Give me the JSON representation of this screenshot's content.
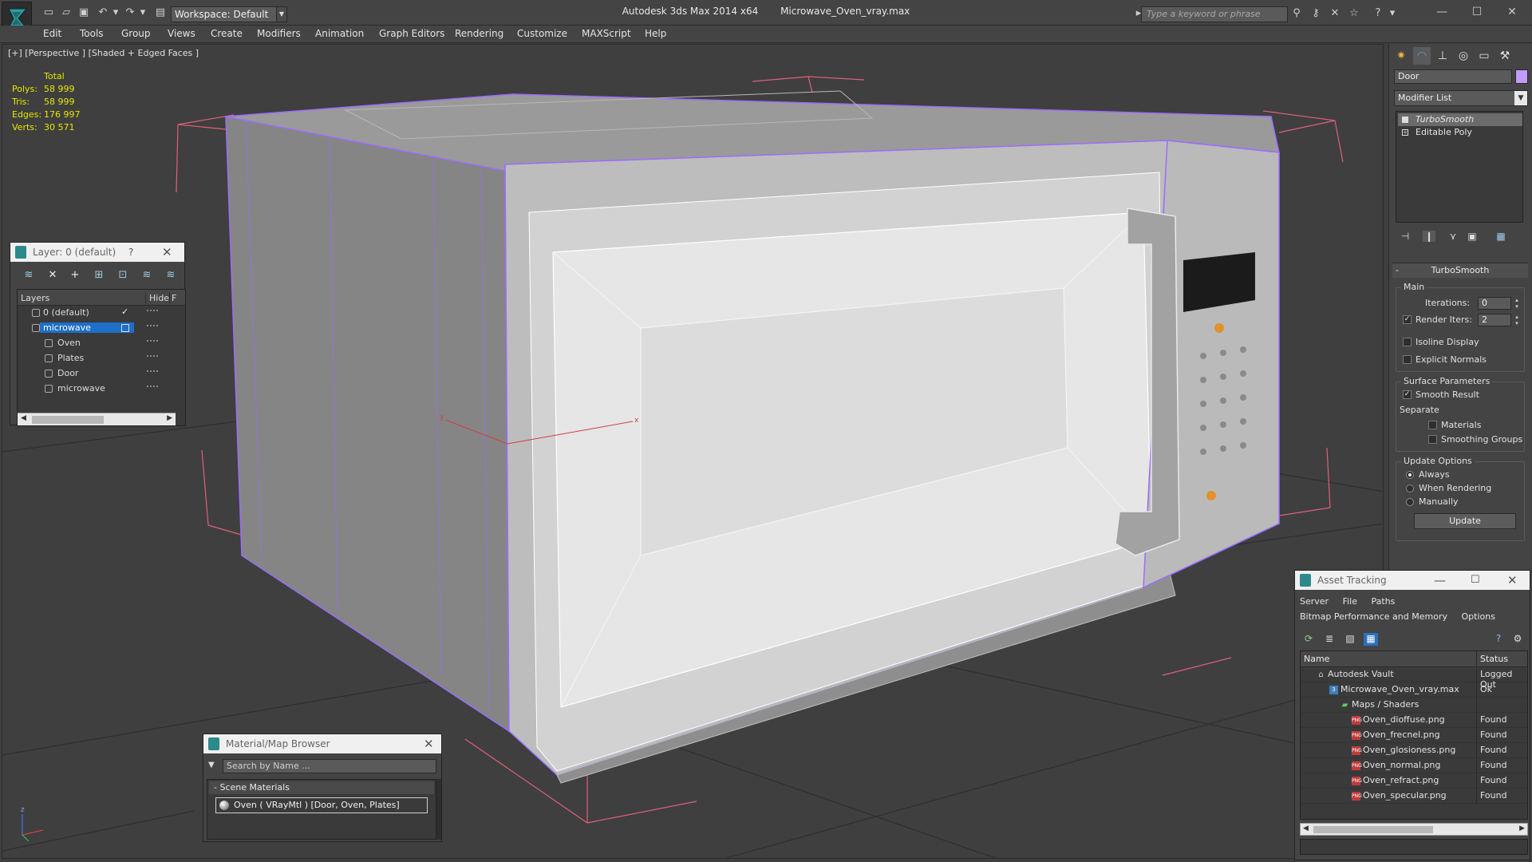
{
  "titlebar": {
    "app_title": "Autodesk 3ds Max  2014 x64",
    "file_title": "Microwave_Oven_vray.max",
    "workspace": "Workspace: Default",
    "search_placeholder": "Type a keyword or phrase"
  },
  "menu": [
    "Edit",
    "Tools",
    "Group",
    "Views",
    "Create",
    "Modifiers",
    "Animation",
    "Graph Editors",
    "Rendering",
    "Customize",
    "MAXScript",
    "Help"
  ],
  "viewport": {
    "label": "[+] [Perspective ] [Shaded + Edged Faces ]",
    "stats": {
      "total_label": "Total",
      "rows": [
        {
          "label": "Polys:",
          "value": "58 999"
        },
        {
          "label": "Tris:",
          "value": "58 999"
        },
        {
          "label": "Edges:",
          "value": "176 997"
        },
        {
          "label": "Verts:",
          "value": "30 571"
        }
      ]
    },
    "gizmo_x": "x",
    "gizmo_y": "y",
    "gizmo_z": "z"
  },
  "layer_dialog": {
    "title": "Layer: 0 (default)",
    "help": "?",
    "col_layers": "Layers",
    "col_hide": "Hide",
    "col_f": "F",
    "rows": [
      {
        "name": "0 (default)",
        "indent": 0
      },
      {
        "name": "microwave",
        "indent": 0
      },
      {
        "name": "Oven",
        "indent": 1
      },
      {
        "name": "Plates",
        "indent": 1
      },
      {
        "name": "Door",
        "indent": 1
      },
      {
        "name": "microwave",
        "indent": 1
      }
    ]
  },
  "command_panel": {
    "object_name": "Door",
    "object_color": "#c29bff",
    "modifier_list": "Modifier List",
    "stack": [
      "TurboSmooth",
      "Editable Poly"
    ],
    "rollout_title": "TurboSmooth",
    "main_group": "Main",
    "iterations_label": "Iterations:",
    "iterations_value": "0",
    "render_iters_label": "Render Iters:",
    "render_iters_value": "2",
    "isoline_label": "Isoline Display",
    "explicit_normals_label": "Explicit Normals",
    "surface_group": "Surface Parameters",
    "smooth_result_label": "Smooth Result",
    "separate_label": "Separate",
    "materials_label": "Materials",
    "smoothing_groups_label": "Smoothing Groups",
    "update_group": "Update Options",
    "update_options": [
      "Always",
      "When Rendering",
      "Manually"
    ],
    "update_button": "Update"
  },
  "asset_tracking": {
    "title": "Asset Tracking",
    "menu1": [
      "Server",
      "File",
      "Paths"
    ],
    "menu2": [
      "Bitmap Performance and Memory",
      "Options"
    ],
    "col_name": "Name",
    "col_status": "Status",
    "rows": [
      {
        "name": "Autodesk Vault",
        "status": "Logged Out",
        "indent": 0,
        "icon": "vault"
      },
      {
        "name": "Microwave_Oven_vray.max",
        "status": "Ok",
        "indent": 1,
        "icon": "max"
      },
      {
        "name": "Maps / Shaders",
        "status": "",
        "indent": 2,
        "icon": "maps"
      },
      {
        "name": "Oven_dioffuse.png",
        "status": "Found",
        "indent": 3,
        "icon": "png"
      },
      {
        "name": "Oven_frecnel.png",
        "status": "Found",
        "indent": 3,
        "icon": "png"
      },
      {
        "name": "Oven_glosioness.png",
        "status": "Found",
        "indent": 3,
        "icon": "png"
      },
      {
        "name": "Oven_normal.png",
        "status": "Found",
        "indent": 3,
        "icon": "png"
      },
      {
        "name": "Oven_refract.png",
        "status": "Found",
        "indent": 3,
        "icon": "png"
      },
      {
        "name": "Oven_specular.png",
        "status": "Found",
        "indent": 3,
        "icon": "png"
      }
    ]
  },
  "material_browser": {
    "title": "Material/Map Browser",
    "search_placeholder": "Search by Name ...",
    "group": "Scene Materials",
    "item": "Oven  ( VRayMtl )  [Door, Oven, Plates]"
  },
  "colors": {
    "wire_selected": "#9b6cff",
    "bbox": "#e0607a",
    "stats_text": "#e6e600",
    "selection": "#1e6fc8"
  }
}
